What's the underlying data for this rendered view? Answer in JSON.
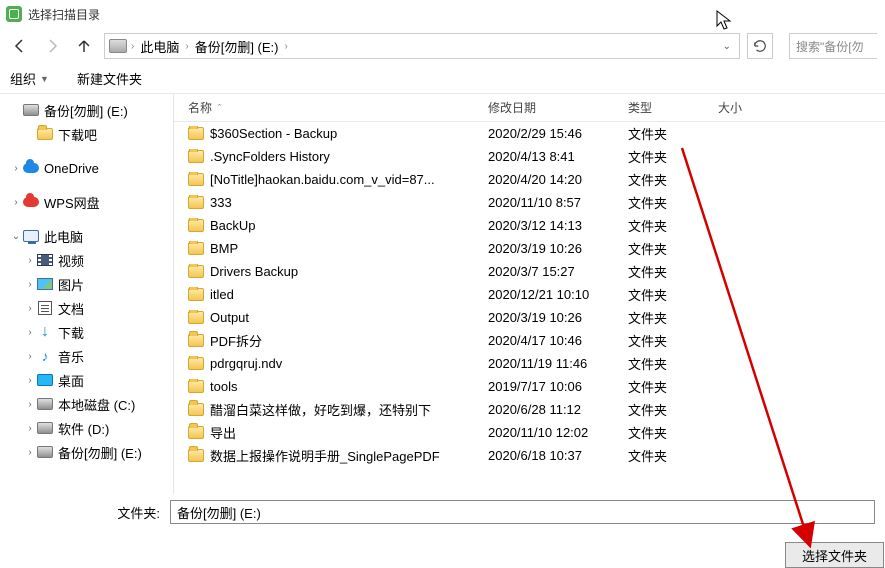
{
  "window": {
    "title": "选择扫描目录"
  },
  "breadcrumb": {
    "root": "此电脑",
    "current": "备份[勿删] (E:)"
  },
  "search": {
    "placeholder": "搜索\"备份[勿"
  },
  "toolbar": {
    "organize": "组织",
    "new_folder": "新建文件夹"
  },
  "columns": {
    "name": "名称",
    "date": "修改日期",
    "type": "类型",
    "size": "大小"
  },
  "sidebar": {
    "items": [
      {
        "depth": 0,
        "icon": "drive",
        "label": "备份[勿删] (E:)",
        "expander": ""
      },
      {
        "depth": 1,
        "icon": "folder",
        "label": "下载吧",
        "expander": ""
      },
      {
        "depth": 0,
        "spacer": true
      },
      {
        "depth": 0,
        "icon": "cloud-blue",
        "label": "OneDrive",
        "expander": "›"
      },
      {
        "depth": 0,
        "spacer": true
      },
      {
        "depth": 0,
        "icon": "cloud-red",
        "label": "WPS网盘",
        "expander": "›"
      },
      {
        "depth": 0,
        "spacer": true
      },
      {
        "depth": 0,
        "icon": "pc",
        "label": "此电脑",
        "expander": "⌄"
      },
      {
        "depth": 1,
        "icon": "video",
        "label": "视频",
        "expander": "›"
      },
      {
        "depth": 1,
        "icon": "pic",
        "label": "图片",
        "expander": "›"
      },
      {
        "depth": 1,
        "icon": "doc",
        "label": "文档",
        "expander": "›"
      },
      {
        "depth": 1,
        "icon": "dl",
        "label": "下载",
        "expander": "›"
      },
      {
        "depth": 1,
        "icon": "music",
        "label": "音乐",
        "expander": "›"
      },
      {
        "depth": 1,
        "icon": "desktop",
        "label": "桌面",
        "expander": "›"
      },
      {
        "depth": 1,
        "icon": "drive",
        "label": "本地磁盘 (C:)",
        "expander": "›"
      },
      {
        "depth": 1,
        "icon": "drive",
        "label": "软件 (D:)",
        "expander": "›"
      },
      {
        "depth": 1,
        "icon": "drive",
        "label": "备份[勿删] (E:)",
        "expander": "›"
      }
    ]
  },
  "files": [
    {
      "name": "$360Section - Backup",
      "date": "2020/2/29 15:46",
      "type": "文件夹"
    },
    {
      "name": ".SyncFolders History",
      "date": "2020/4/13 8:41",
      "type": "文件夹"
    },
    {
      "name": "[NoTitle]haokan.baidu.com_v_vid=87...",
      "date": "2020/4/20 14:20",
      "type": "文件夹"
    },
    {
      "name": "333",
      "date": "2020/11/10 8:57",
      "type": "文件夹"
    },
    {
      "name": "BackUp",
      "date": "2020/3/12 14:13",
      "type": "文件夹"
    },
    {
      "name": "BMP",
      "date": "2020/3/19 10:26",
      "type": "文件夹"
    },
    {
      "name": "Drivers Backup",
      "date": "2020/3/7 15:27",
      "type": "文件夹"
    },
    {
      "name": "itled",
      "date": "2020/12/21 10:10",
      "type": "文件夹"
    },
    {
      "name": "Output",
      "date": "2020/3/19 10:26",
      "type": "文件夹"
    },
    {
      "name": "PDF拆分",
      "date": "2020/4/17 10:46",
      "type": "文件夹"
    },
    {
      "name": "pdrgqruj.ndv",
      "date": "2020/11/19 11:46",
      "type": "文件夹"
    },
    {
      "name": "tools",
      "date": "2019/7/17 10:06",
      "type": "文件夹"
    },
    {
      "name": "醋溜白菜这样做，好吃到爆，还特别下",
      "date": "2020/6/28 11:12",
      "type": "文件夹"
    },
    {
      "name": "导出",
      "date": "2020/11/10 12:02",
      "type": "文件夹"
    },
    {
      "name": "数据上报操作说明手册_SinglePagePDF",
      "date": "2020/6/18 10:37",
      "type": "文件夹"
    }
  ],
  "footer": {
    "folder_label": "文件夹:",
    "folder_value": "备份[勿删] (E:)",
    "select_button": "选择文件夹"
  }
}
